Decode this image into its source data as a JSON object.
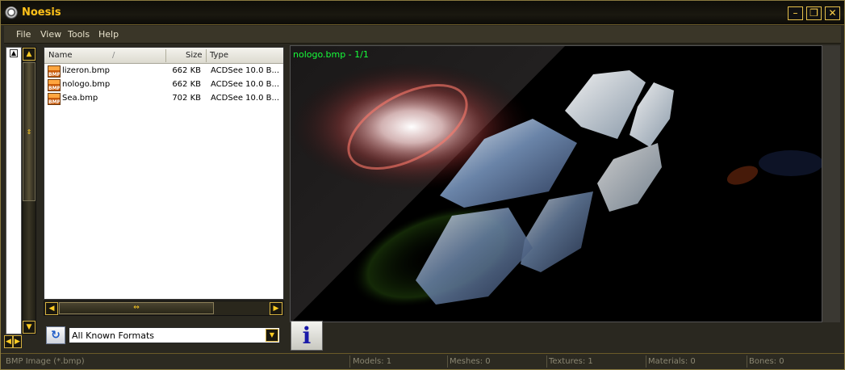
{
  "window": {
    "title": "Noesis"
  },
  "window_buttons": {
    "minimize": "–",
    "maximize": "❐",
    "close": "✕"
  },
  "menu": [
    "File",
    "View",
    "Tools",
    "Help"
  ],
  "file_list": {
    "columns": {
      "name": "Name",
      "sort_indicator": "/",
      "size": "Size",
      "type": "Type"
    },
    "rows": [
      {
        "icon": "bmp-file-icon",
        "icon_text": "BMP",
        "name": "lizeron.bmp",
        "size": "662 KB",
        "type": "ACDSee 10.0 B..."
      },
      {
        "icon": "bmp-file-icon",
        "icon_text": "BMP",
        "name": "nologo.bmp",
        "size": "662 KB",
        "type": "ACDSee 10.0 B..."
      },
      {
        "icon": "bmp-file-icon",
        "icon_text": "BMP",
        "name": "Sea.bmp",
        "size": "702 KB",
        "type": "ACDSee 10.0 B..."
      }
    ]
  },
  "format_filter": {
    "selected": "All Known Formats"
  },
  "preview": {
    "label": "nologo.bmp - 1/1"
  },
  "info_button": {
    "glyph": "i"
  },
  "statusbar": {
    "filter": "BMP Image (*.bmp)",
    "models": "Models: 1",
    "meshes": "Meshes: 0",
    "textures": "Textures: 1",
    "materials": "Materials: 0",
    "bones": "Bones: 0"
  },
  "colors": {
    "accent": "#ffc21a",
    "preview_label": "#16ff3a",
    "frame": "#2a2820"
  }
}
